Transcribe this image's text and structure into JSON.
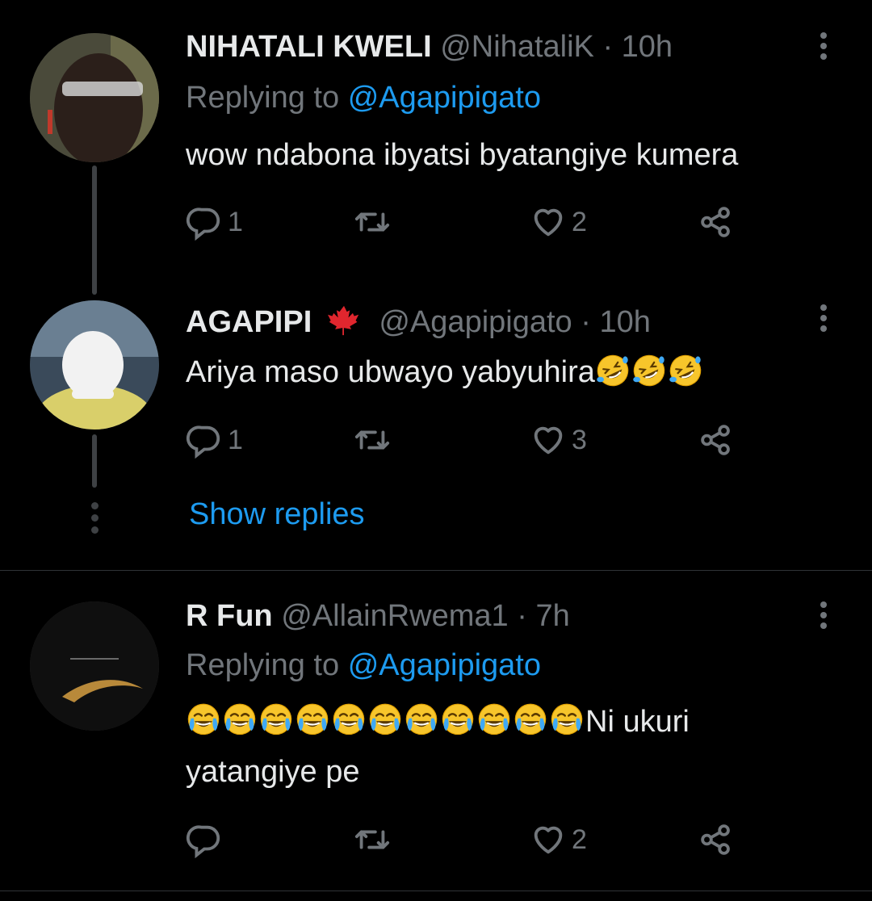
{
  "tweets": [
    {
      "name": "NIHATALI KWELI",
      "handle": "@NihataliK",
      "dot": "·",
      "time": "10h",
      "replying_prefix": "Replying to",
      "replying_mention": "@Agapipigato",
      "text": "wow ndabona ibyatsi byatangiye kumera",
      "reply_count": "1",
      "retweet_count": "",
      "like_count": "2"
    },
    {
      "name": "AGAPIPI",
      "flag": "maple-leaf-icon",
      "handle": "@Agapipigato",
      "dot": "·",
      "time": "10h",
      "text": "Ariya maso ubwayo yabyuhira",
      "emoji": "rolling-on-floor-laughing-emoji",
      "emoji_count": 3,
      "reply_count": "1",
      "retweet_count": "",
      "like_count": "3"
    },
    {
      "name": "R Fun",
      "handle": "@AllainRwema1",
      "dot": "·",
      "time": "7h",
      "replying_prefix": "Replying to",
      "replying_mention": "@Agapipigato",
      "text_suffix_line1": "Ni ukuri",
      "text_line2": "yatangiye pe",
      "emoji": "tears-of-joy-emoji",
      "emoji_count": 11,
      "reply_count": "",
      "retweet_count": "",
      "like_count": "2"
    }
  ],
  "show_replies_label": "Show replies",
  "colors": {
    "background": "#000000",
    "text": "#e7e9ea",
    "secondary": "#71767b",
    "link": "#1d9bf0",
    "flag_red": "#e0262e"
  }
}
